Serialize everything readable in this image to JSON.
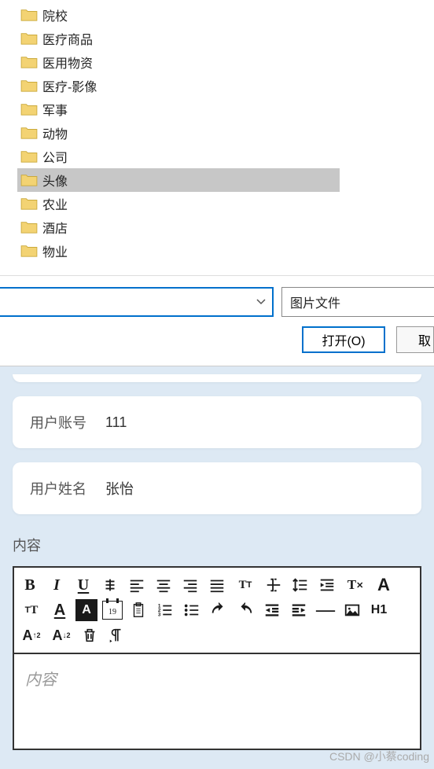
{
  "folders": [
    {
      "name": "院校",
      "selected": false
    },
    {
      "name": "医疗商品",
      "selected": false
    },
    {
      "name": "医用物资",
      "selected": false
    },
    {
      "name": "医疗-影像",
      "selected": false
    },
    {
      "name": "军事",
      "selected": false
    },
    {
      "name": "动物",
      "selected": false
    },
    {
      "name": "公司",
      "selected": false
    },
    {
      "name": "头像",
      "selected": true
    },
    {
      "name": "农业",
      "selected": false
    },
    {
      "name": "酒店",
      "selected": false
    },
    {
      "name": "物业",
      "selected": false
    }
  ],
  "dialog": {
    "filename": "",
    "filter_label": "图片文件",
    "open_button": "打开(O)",
    "cancel_fragment": "取"
  },
  "form": {
    "account_label": "用户账号",
    "account_value": "111",
    "name_label": "用户姓名",
    "name_value": "张怡"
  },
  "content_label": "内容",
  "editor": {
    "placeholder": "内容",
    "calendar_day": "19"
  },
  "watermark": "CSDN @小蔡coding"
}
